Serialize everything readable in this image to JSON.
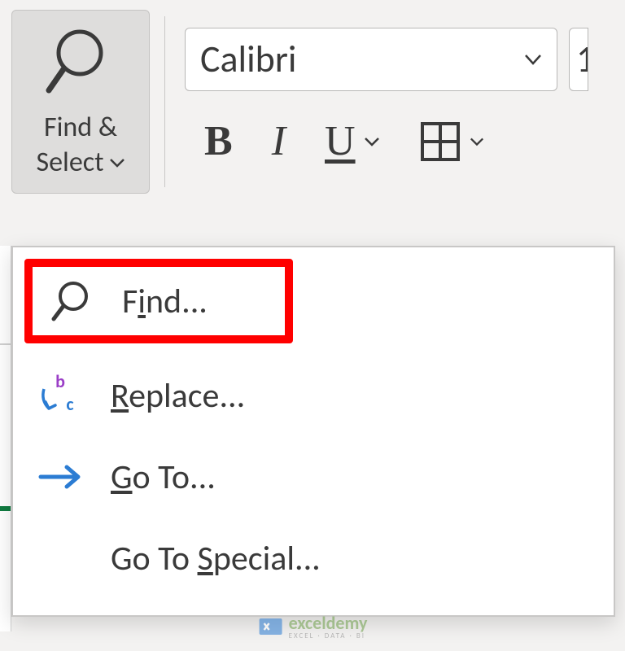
{
  "ribbon": {
    "find_select": {
      "line1": "Find &",
      "line2": "Select"
    },
    "font_name": "Calibri",
    "font_size_partial": "1",
    "bold_label": "B",
    "italic_label": "I",
    "underline_label": "U"
  },
  "menu": {
    "find": {
      "prefix": "F",
      "mnemonic": "i",
      "suffix": "nd..."
    },
    "replace": {
      "mnemonic": "R",
      "suffix": "eplace...",
      "icon_b": "b",
      "icon_c": "c"
    },
    "goto": {
      "mnemonic": "G",
      "suffix": "o To..."
    },
    "goto_special": {
      "prefix": "Go To ",
      "mnemonic": "S",
      "suffix": "pecial..."
    }
  },
  "watermark": {
    "brand": "exceldemy",
    "tagline": "EXCEL · DATA · BI"
  }
}
